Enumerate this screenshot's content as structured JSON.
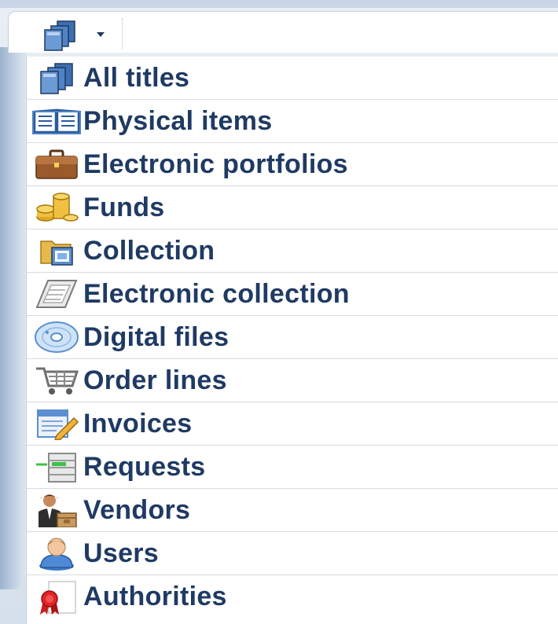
{
  "combo": {
    "selected_icon": "stacked-books-icon"
  },
  "menu": {
    "items": [
      {
        "label": "All titles",
        "icon": "stacked-books-icon"
      },
      {
        "label": "Physical items",
        "icon": "open-book-icon"
      },
      {
        "label": "Electronic portfolios",
        "icon": "briefcase-icon"
      },
      {
        "label": "Funds",
        "icon": "coins-icon"
      },
      {
        "label": "Collection",
        "icon": "folder-icon"
      },
      {
        "label": "Electronic collection",
        "icon": "electronic-collection-icon"
      },
      {
        "label": "Digital files",
        "icon": "disc-icon"
      },
      {
        "label": "Order lines",
        "icon": "shopping-cart-icon"
      },
      {
        "label": "Invoices",
        "icon": "invoice-pencil-icon"
      },
      {
        "label": "Requests",
        "icon": "requests-icon"
      },
      {
        "label": "Vendors",
        "icon": "vendor-icon"
      },
      {
        "label": "Users",
        "icon": "user-icon"
      },
      {
        "label": "Authorities",
        "icon": "ribbon-icon"
      }
    ]
  },
  "colors": {
    "label_text": "#1f3a63",
    "divider": "#d7dbe0",
    "menu_background": "#ffffff"
  }
}
